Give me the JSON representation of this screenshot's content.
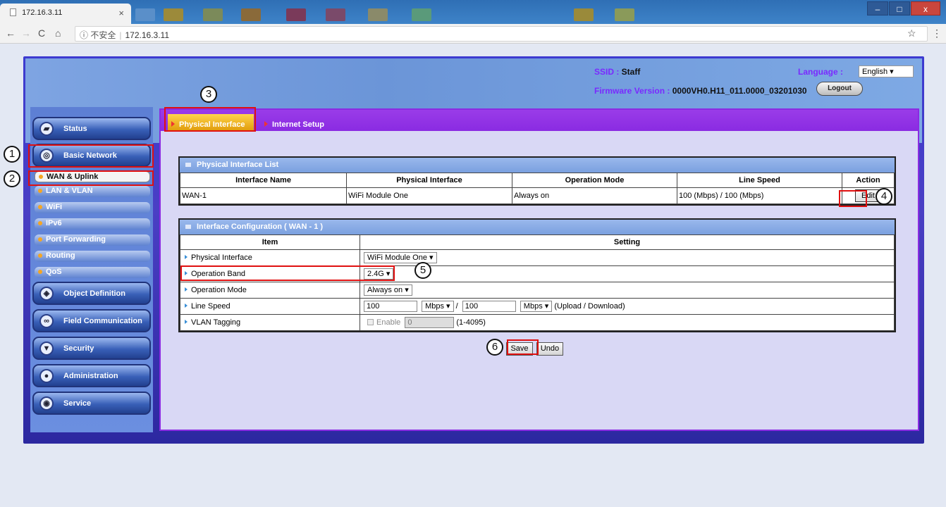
{
  "browser": {
    "tab_title": "172.16.3.11",
    "tab_close": "×",
    "back": "←",
    "forward": "→",
    "reload": "C",
    "home": "⌂",
    "security_icon": "ⓘ",
    "security_label": "不安全",
    "url": "172.16.3.11",
    "bookmark": "☆",
    "menu": "⋮",
    "window_controls": {
      "minimize": "–",
      "maximize": "□",
      "close": "x"
    }
  },
  "header": {
    "ssid_label": "SSID : ",
    "ssid_value": "Staff",
    "firmware_label": "Firmware Version : ",
    "firmware_value": "0000VH0.H11_011.0000_03201030",
    "language_label": "Language : ",
    "language_value": "English ▾",
    "logout_label": "Logout"
  },
  "sidebar": {
    "status": "Status",
    "basic_network": "Basic Network",
    "sub_items": [
      "WAN & Uplink",
      "LAN & VLAN",
      "WiFi",
      "IPv6",
      "Port Forwarding",
      "Routing",
      "QoS"
    ],
    "object_definition": "Object Definition",
    "field_communication": "Field Communication",
    "security": "Security",
    "administration": "Administration",
    "service": "Service"
  },
  "tabs": {
    "physical_interface": "Physical Interface",
    "internet_setup": "Internet Setup"
  },
  "interface_list": {
    "title": "Physical Interface List",
    "columns": [
      "Interface Name",
      "Physical Interface",
      "Operation Mode",
      "Line Speed",
      "Action"
    ],
    "row": {
      "name": "WAN-1",
      "physical": "WiFi Module One",
      "mode": "Always on",
      "speed": "100 (Mbps) / 100 (Mbps)",
      "action": "Edit"
    }
  },
  "config": {
    "title": "Interface Configuration ( WAN - 1 )",
    "col_item": "Item",
    "col_setting": "Setting",
    "rows": {
      "physical_label": "Physical Interface",
      "physical_value": "WiFi Module One ▾",
      "band_label": "Operation Band",
      "band_value": "2.4G ▾",
      "mode_label": "Operation Mode",
      "mode_value": "Always on ▾",
      "speed_label": "Line Speed",
      "speed_up": "100",
      "speed_up_unit": "Mbps ▾",
      "speed_sep": "/",
      "speed_down": "100",
      "speed_down_unit": "Mbps ▾",
      "speed_note": "(Upload / Download)",
      "vlan_label": "VLAN Tagging",
      "vlan_enable": "Enable",
      "vlan_value": "0",
      "vlan_range": "(1-4095)"
    }
  },
  "actions": {
    "save": "Save",
    "undo": "Undo"
  },
  "callouts": [
    "1",
    "2",
    "3",
    "4",
    "5",
    "6"
  ],
  "colors": {
    "accent": "#8a2be2",
    "annotation": "#e01010",
    "label": "#7a29ff"
  }
}
